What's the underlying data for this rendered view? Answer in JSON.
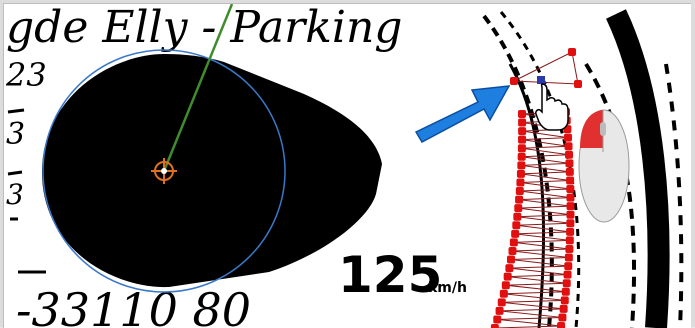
{
  "handwriting": {
    "top_line": "gde Elly - Parking",
    "left_top": "23",
    "left_mid_1": "3",
    "left_mid_2": "3",
    "bottom_line": "-33110 80"
  },
  "speed_label": {
    "value": "125",
    "unit": "km/h"
  },
  "colors": {
    "ink": "#000000",
    "circle_outline": "#3a78c8",
    "needle": "#3f8c2c",
    "pivot": "#e07020",
    "control_point": "#e01010",
    "selected_point": "#2a3aa8",
    "stroke_lines": "#8a1a1a",
    "arrow_fill": "#1e7fe0",
    "arrow_edge": "#0a4fa0",
    "mouse_body": "#e8e8e8",
    "mouse_button": "#e03030"
  },
  "icons": {
    "cursor": "hand-pointer-icon",
    "hint_arrow": "blue-arrow-icon",
    "mouse": "mouse-left-click-icon"
  }
}
